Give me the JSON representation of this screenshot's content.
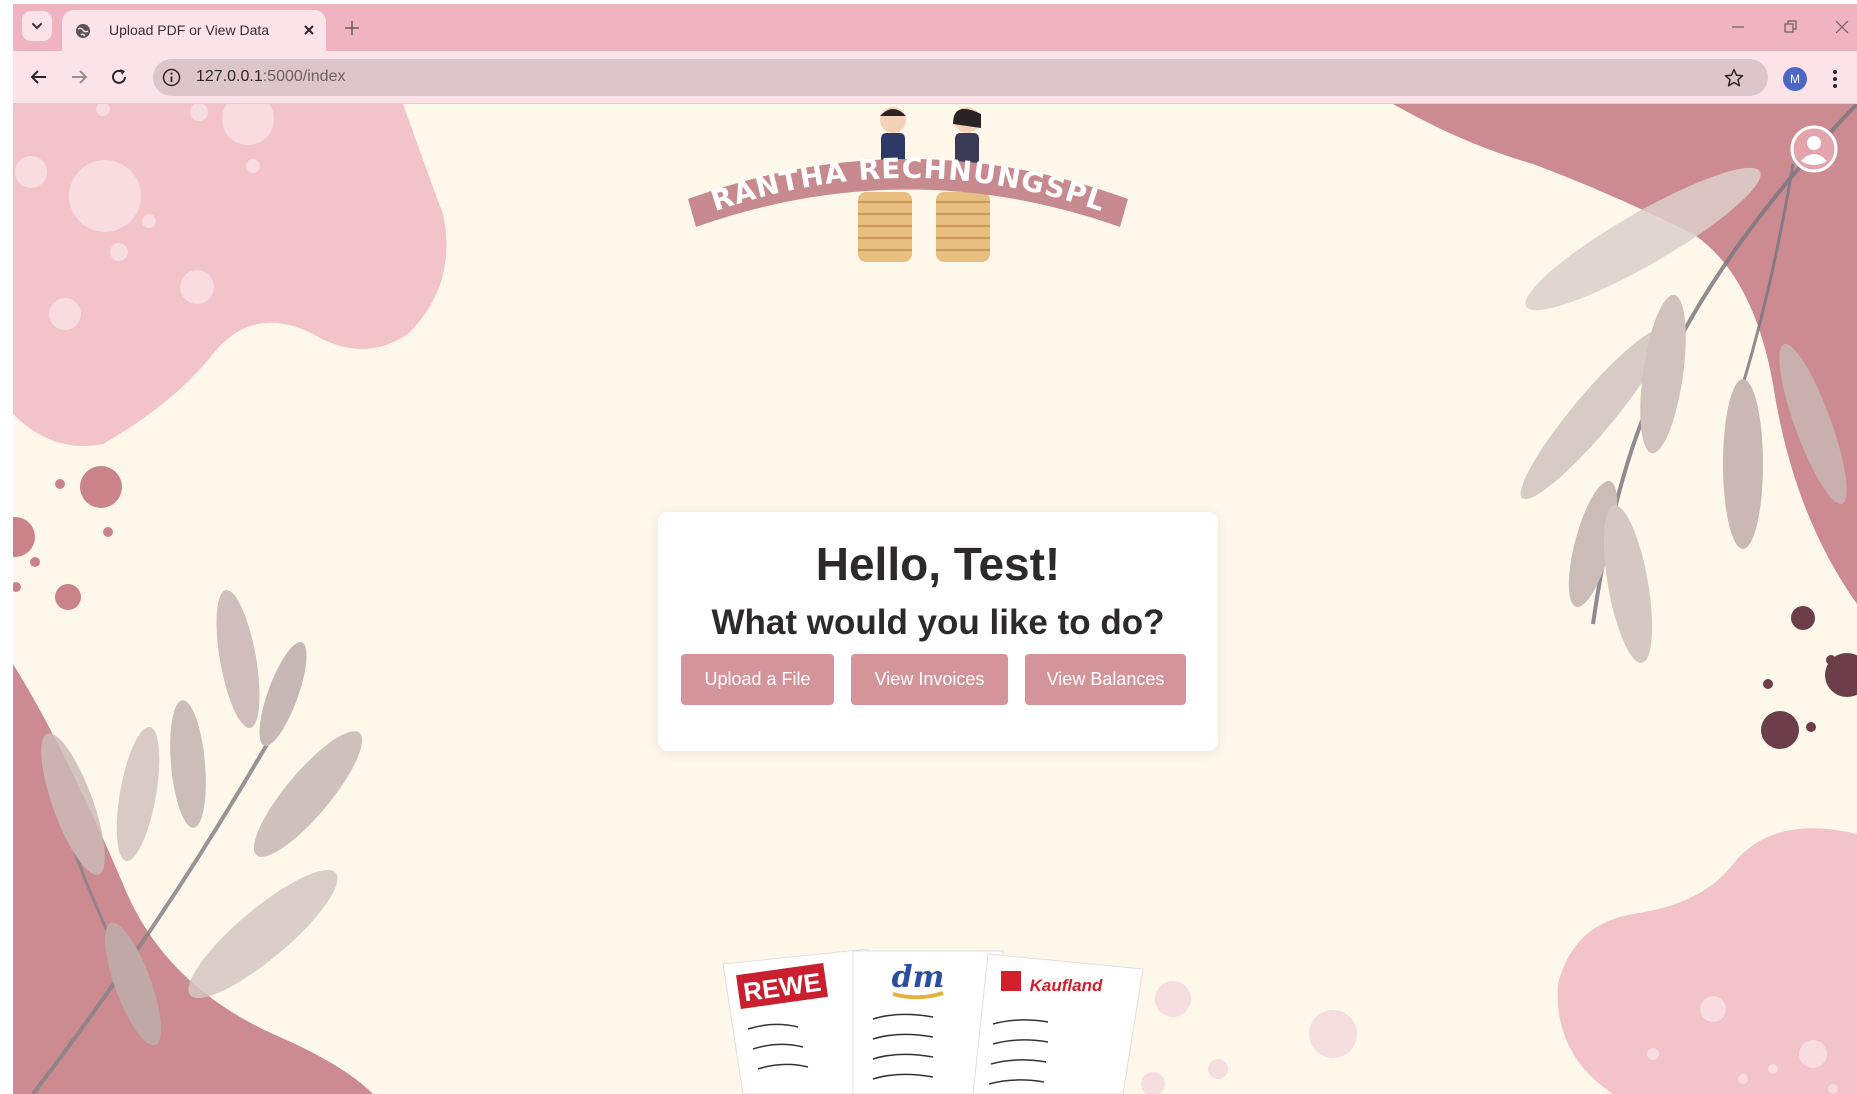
{
  "browser": {
    "tab": {
      "title": "Upload PDF or View Data"
    },
    "address_bar": {
      "host": "127.0.0.1",
      "path": ":5000/index"
    },
    "profile_initial": "M"
  },
  "page": {
    "logo": {
      "text": "SIRANTHA RECHNUNGSPLIT"
    },
    "card": {
      "greeting": "Hello, Test!",
      "prompt": "What would you like to do?",
      "buttons": {
        "upload": "Upload a File",
        "invoices": "View Invoices",
        "balances": "View Balances"
      }
    },
    "receipts": {
      "stores": [
        "REWE",
        "dm",
        "Kaufland"
      ]
    }
  },
  "colors": {
    "tabstrip": "#efb4c0",
    "toolbar": "#fbe3e8",
    "page_background": "#fdf8ea",
    "button": "#d4959a",
    "blob_light": "#f2c3c8",
    "blob_dark": "#cc8b90",
    "profile_badge": "#4d67c7"
  }
}
